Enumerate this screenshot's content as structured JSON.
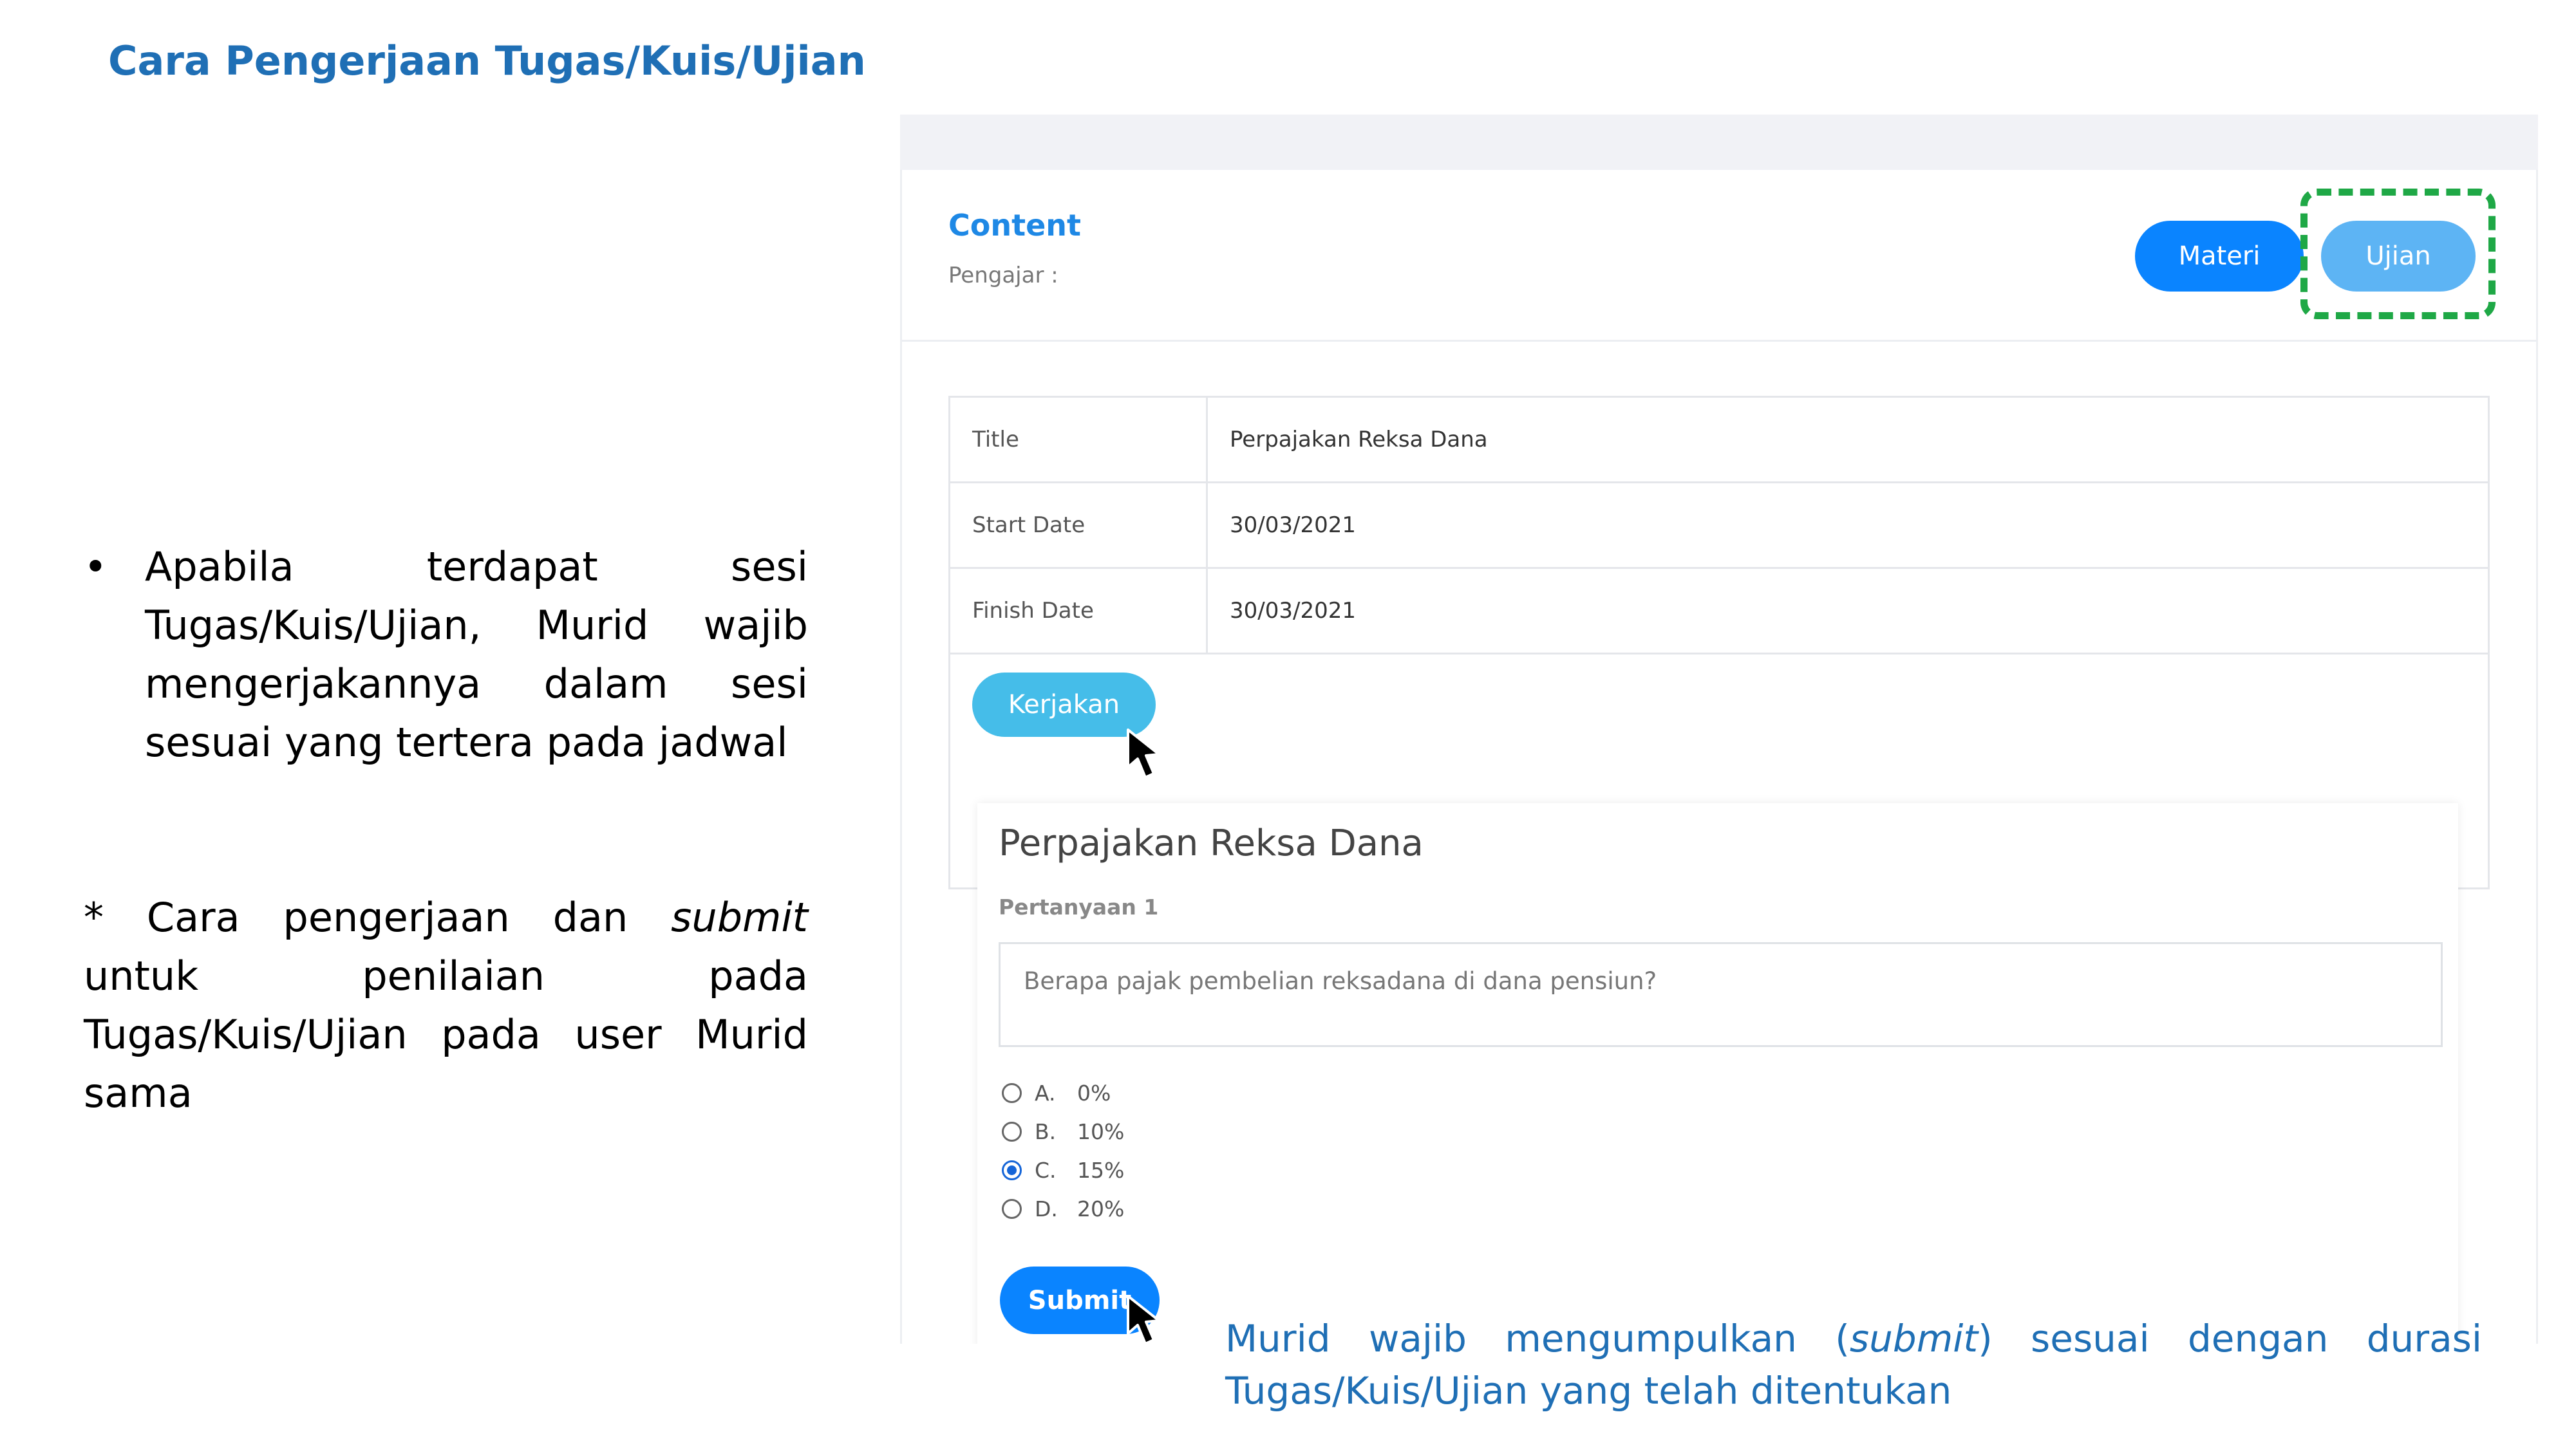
{
  "slide": {
    "title": "Cara Pengerjaan Tugas/Kuis/Ujian",
    "bullet": "Apabila terdapat sesi Tugas/Kuis/Ujian, Murid wajib mengerjakannya dalam sesi sesuai yang tertera pada jadwal",
    "bullet_symbol": "•",
    "note_prefix": "* Cara pengerjaan dan ",
    "note_emphasis": "submit",
    "note_suffix": " untuk penilaian pada Tugas/Kuis/Ujian pada user Murid sama",
    "footer_prefix": "Murid wajib mengumpulkan (",
    "footer_emphasis": "submit",
    "footer_suffix": ") sesuai dengan durasi Tugas/Kuis/Ujian yang telah ditentukan"
  },
  "screen": {
    "header": {
      "title": "Content",
      "teacher_label": "Pengajar :",
      "buttons": {
        "materi": "Materi",
        "ujian": "Ujian"
      }
    },
    "info": {
      "rows": [
        {
          "label": "Title",
          "value": "Perpajakan Reksa Dana"
        },
        {
          "label": "Start Date",
          "value": "30/03/2021"
        },
        {
          "label": "Finish Date",
          "value": "30/03/2021"
        }
      ],
      "action": "Kerjakan"
    },
    "quiz": {
      "title": "Perpajakan Reksa Dana",
      "question_label": "Pertanyaan 1",
      "question": "Berapa pajak pembelian reksadana di dana pensiun?",
      "options": [
        {
          "letter": "A.",
          "value": "0%",
          "selected": false
        },
        {
          "letter": "B.",
          "value": "10%",
          "selected": false
        },
        {
          "letter": "C.",
          "value": "15%",
          "selected": true
        },
        {
          "letter": "D.",
          "value": "20%",
          "selected": false
        }
      ],
      "submit": "Submit"
    }
  },
  "colors": {
    "accent_blue": "#1f6fb5",
    "primary_button": "#0a84ff",
    "light_button": "#5db4f4",
    "kerjakan_button": "#45bde9",
    "highlight_green": "#1fa846"
  },
  "icons": [
    "mouse-pointer-icon"
  ]
}
